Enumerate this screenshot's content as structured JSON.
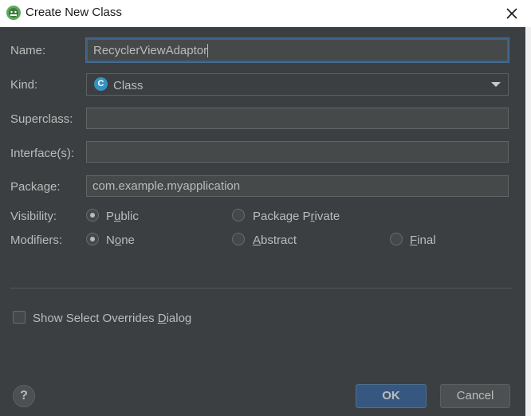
{
  "window": {
    "title": "Create New Class",
    "app_icon": "android-studio-icon",
    "close_icon": "close-icon"
  },
  "form": {
    "name_label": "Name:",
    "name_value": "RecyclerViewAdaptor",
    "kind_label": "Kind:",
    "kind_value": "Class",
    "kind_icon_letter": "C",
    "superclass_label": "Superclass:",
    "superclass_value": "",
    "interfaces_label": "Interface(s):",
    "interfaces_value": "",
    "package_label": "Package:",
    "package_value": "com.example.myapplication",
    "visibility_label": "Visibility:",
    "visibility_options": [
      {
        "pre": "P",
        "mn": "u",
        "post": "blic",
        "checked": true
      },
      {
        "pre": "Package P",
        "mn": "r",
        "post": "ivate",
        "checked": false
      }
    ],
    "modifiers_label": "Modifiers:",
    "modifier_options": [
      {
        "pre": "N",
        "mn": "o",
        "post": "ne",
        "checked": true
      },
      {
        "pre": "",
        "mn": "A",
        "post": "bstract",
        "checked": false
      },
      {
        "pre": "",
        "mn": "F",
        "post": "inal",
        "checked": false
      }
    ],
    "overrides_checkbox": {
      "pre": "Show Select Overrides ",
      "mn": "D",
      "post": "ialog",
      "checked": false
    }
  },
  "footer": {
    "help_label": "?",
    "ok_label": "OK",
    "cancel_label": "Cancel"
  },
  "colors": {
    "background": "#3c3f41",
    "accent": "#365880",
    "focus_border": "#3d6185",
    "class_icon": "#3592c4"
  }
}
